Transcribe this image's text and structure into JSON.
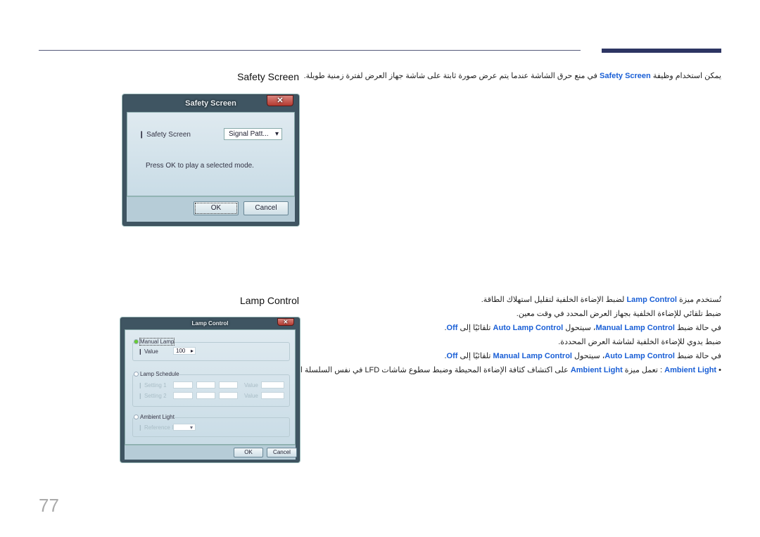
{
  "sections": {
    "safety_heading": "Safety Screen",
    "lamp_heading": "Lamp Control"
  },
  "text_lines": [
    [
      {
        "t": "يمكن استخدام وظيفة "
      },
      {
        "t": "Safety Screen",
        "hl": true
      },
      {
        "t": " في منع حرق الشاشة عندما يتم عرض صورة ثابتة على شاشة جهاز العرض لفترة زمنية طويلة."
      }
    ],
    [
      {
        "t": "تُستخدم ميزة "
      },
      {
        "t": "Lamp Control",
        "hl": true
      },
      {
        "t": " لضبط الإضاءة الخلفية لتقليل استهلاك الطاقة."
      }
    ],
    [
      {
        "t": "ضبط تلقائي للإضاءة الخلفية بجهاز العرض المحدد في وقت معين."
      }
    ],
    [
      {
        "t": "في حالة ضبط "
      },
      {
        "t": "Manual Lamp Control",
        "hl": true
      },
      {
        "t": "، سيتحول "
      },
      {
        "t": "Auto Lamp Control",
        "hl": true
      },
      {
        "t": " تلقائيًا إلى "
      },
      {
        "t": "Off",
        "hl": true
      },
      {
        "t": "."
      }
    ],
    [
      {
        "t": "ضبط يدوي للإضاءة الخلفية لشاشة العرض المحددة."
      }
    ],
    [
      {
        "t": "في حالة ضبط "
      },
      {
        "t": "Auto Lamp Control",
        "hl": true
      },
      {
        "t": "، سيتحول "
      },
      {
        "t": "Manual Lamp Control",
        "hl": true
      },
      {
        "t": " تلقائيًا إلى "
      },
      {
        "t": "Off",
        "hl": true
      },
      {
        "t": "."
      }
    ],
    [
      {
        "t": "•    "
      },
      {
        "t": "Ambient Light",
        "hl": true
      },
      {
        "t": " : تعمل ميزة "
      },
      {
        "t": "Ambient Light",
        "hl": true
      },
      {
        "t": " على اكتشاف كثافة الإضاءة المحيطة وضبط سطوع شاشات LFD  في نفس السلسلة التسلسلية."
      }
    ]
  ],
  "safety_dialog": {
    "title": "Safety Screen",
    "close": "✕",
    "field_label": "Safety Screen",
    "field_value": "Signal Patt...",
    "message": "Press OK to play a selected mode.",
    "ok": "OK",
    "cancel": "Cancel"
  },
  "lamp_dialog": {
    "title": "Lamp Control",
    "close": "✕",
    "manual_lamp": "Manual Lamp",
    "value_label": "Value",
    "value": "100",
    "lamp_schedule": "Lamp Schedule",
    "setting1": "Setting 1",
    "setting2": "Setting 2",
    "value_short": "Value",
    "ambient_light": "Ambient Light",
    "reference_id": "Reference ID",
    "ok": "OK",
    "cancel": "Cancel"
  },
  "page_number": "77",
  "colors": {
    "highlight": "#1a5fd6",
    "accent_bar": "#2d3563"
  }
}
